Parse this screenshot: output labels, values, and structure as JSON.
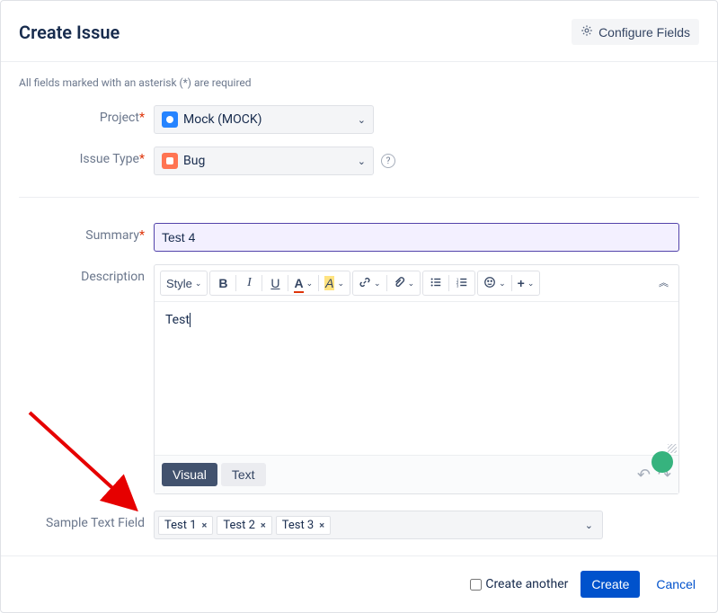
{
  "header": {
    "title": "Create Issue",
    "configure": "Configure Fields"
  },
  "note": "All fields marked with an asterisk (*) are required",
  "labels": {
    "project": "Project",
    "issueType": "Issue Type",
    "summary": "Summary",
    "description": "Description",
    "sampleTextField": "Sample Text Field",
    "asterisk": "*"
  },
  "project": {
    "selected": "Mock (MOCK)"
  },
  "issueType": {
    "selected": "Bug"
  },
  "summary": {
    "value": "Test 4"
  },
  "editor": {
    "styleLabel": "Style",
    "content": "Test",
    "tabs": {
      "visual": "Visual",
      "text": "Text"
    }
  },
  "tags": {
    "items": [
      "Test 1",
      "Test 2",
      "Test 3"
    ]
  },
  "footer": {
    "createAnother": "Create another",
    "create": "Create",
    "cancel": "Cancel"
  },
  "icons": {
    "chevronDown": "⌄",
    "help": "?",
    "bold": "B",
    "italic": "I",
    "underline": "U",
    "textColor": "A",
    "highlight": "A",
    "link": "🔗",
    "attach": "🖇",
    "ul": "≣",
    "ol": "≡",
    "emoji": "☺",
    "plus": "+",
    "collapse": "⌃",
    "undo": "↶",
    "redo": "↷",
    "close": "×"
  }
}
